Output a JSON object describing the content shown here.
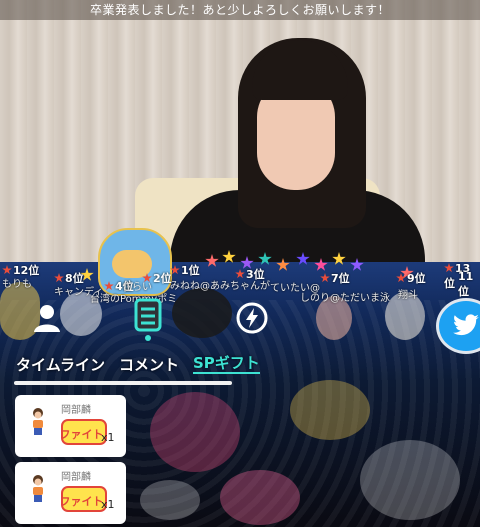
{
  "banner": {
    "text": "卒業発表しました！あと少しよろしくお願いします！"
  },
  "rankings": [
    {
      "rank": "12位",
      "sub": "もりも"
    },
    {
      "rank": "8位",
      "sub": "キャンディ"
    },
    {
      "rank": "4位",
      "sub": "さらい"
    },
    {
      "rank": "2位",
      "sub": "台湾のPommyポミ"
    },
    {
      "rank": "1位",
      "sub": "みねね@あみちゃんが"
    },
    {
      "rank": "3位",
      "sub": "ていたい@"
    },
    {
      "rank": "7位",
      "sub": "しのり@ただいま泳"
    },
    {
      "rank": "9位",
      "sub": "翔斗"
    },
    {
      "rank": "13位",
      "sub": ""
    },
    {
      "rank": "11位",
      "sub": ""
    }
  ],
  "tabs": {
    "timeline": "タイムライン",
    "comment": "コメント",
    "sp_gift": "SPギフト"
  },
  "gift_cards": [
    {
      "name": "岡部麟",
      "sticker": "ファイト!",
      "count": "x1"
    },
    {
      "name": "岡部麟",
      "sticker": "ファイト!",
      "count": "x1"
    }
  ],
  "icons": {
    "user": "user-icon",
    "list": "list-icon",
    "bolt": "bolt-icon",
    "twitter": "twitter-icon"
  },
  "colors": {
    "accent": "#3de2d3",
    "twitter": "#1da1f2"
  }
}
